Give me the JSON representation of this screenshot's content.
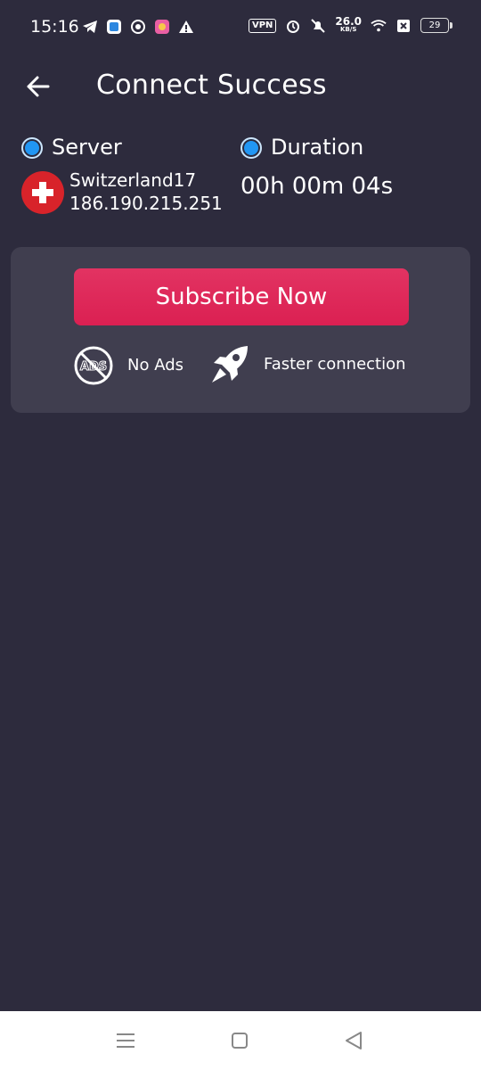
{
  "status_bar": {
    "time": "15:16",
    "vpn": "VPN",
    "net_speed": "26.0",
    "net_unit": "KB/S",
    "battery": "29",
    "icons": [
      "telegram-icon",
      "app-icon",
      "chrome-icon",
      "gallery-icon",
      "warning-icon",
      "alarm-icon",
      "mute-icon",
      "wifi-icon",
      "close-box-icon"
    ]
  },
  "header": {
    "title": "Connect Success",
    "back_icon": "arrow-left-icon"
  },
  "server": {
    "label": "Server",
    "name": "Switzerland17",
    "ip": "186.190.215.251",
    "flag": "switzerland-flag-icon"
  },
  "duration": {
    "label": "Duration",
    "value": "00h 00m 04s"
  },
  "promo": {
    "subscribe_label": "Subscribe Now",
    "features": [
      {
        "icon": "no-ads-icon",
        "label": "No Ads"
      },
      {
        "icon": "rocket-icon",
        "label": "Faster connection"
      }
    ]
  },
  "colors": {
    "background": "#2d2b3d",
    "card": "#403e4f",
    "accent": "#e0295a",
    "radio": "#2196f3"
  },
  "nav_bar": {
    "icons": [
      "menu-icon",
      "home-square-icon",
      "back-triangle-icon"
    ]
  }
}
